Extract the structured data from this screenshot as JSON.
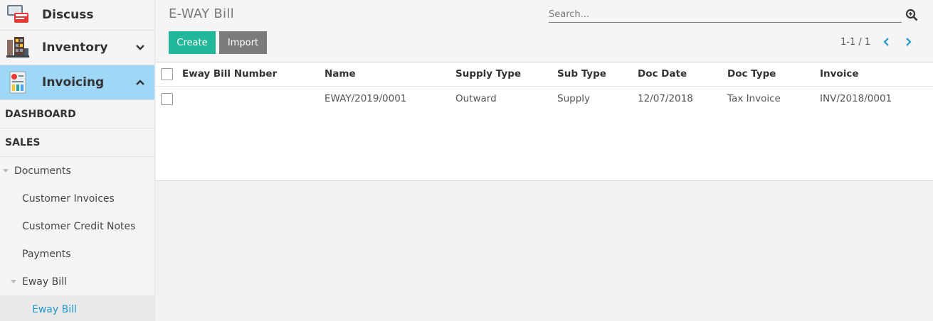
{
  "sidebar": {
    "apps": [
      {
        "label": "Discuss",
        "icon": "discuss-icon"
      },
      {
        "label": "Inventory",
        "icon": "inventory-icon"
      },
      {
        "label": "Invoicing",
        "icon": "invoicing-icon"
      }
    ],
    "sections": [
      "DASHBOARD",
      "SALES"
    ],
    "documents_label": "Documents",
    "items": [
      "Customer Invoices",
      "Customer Credit Notes",
      "Payments"
    ],
    "eway_group_label": "Eway Bill",
    "eway_item_label": "Eway Bill"
  },
  "header": {
    "title": "E-WAY Bill",
    "search_placeholder": "Search...",
    "create_label": "Create",
    "import_label": "Import",
    "pager": "1-1 / 1"
  },
  "table": {
    "columns": [
      "Eway Bill Number",
      "Name",
      "Supply Type",
      "Sub Type",
      "Doc Date",
      "Doc Type",
      "Invoice"
    ],
    "rows": [
      {
        "eway_bill_number": "",
        "name": "EWAY/2019/0001",
        "supply_type": "Outward",
        "sub_type": "Supply",
        "doc_date": "12/07/2018",
        "doc_type": "Tax Invoice",
        "invoice": "INV/2018/0001"
      }
    ]
  },
  "colors": {
    "primary_button": "#21b799",
    "secondary_button": "#7b7b7b",
    "active_app": "#9fd7f7",
    "active_link": "#2196c9",
    "pager_arrows": "#2196c9"
  }
}
